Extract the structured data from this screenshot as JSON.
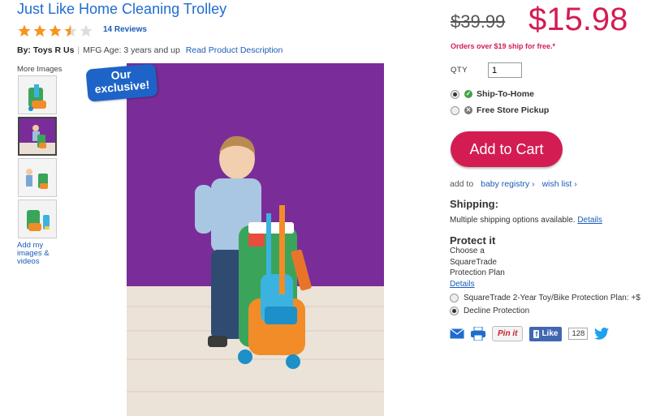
{
  "product": {
    "title": "Just Like Home Cleaning Trolley",
    "rating": 3.5,
    "rating_max": 5,
    "reviews": "14 Reviews",
    "by_label": "By: Toys R Us",
    "mfg_age": "MFG Age: 3 years and up",
    "read_description": "Read Product Description"
  },
  "gallery": {
    "more_images": "More Images",
    "add_mine": "Add my images & videos",
    "badge_line1": "Our",
    "badge_line2": "exclusive!",
    "selected_index": 1
  },
  "pricing": {
    "old_price": "$39.99",
    "new_price": "$15.98",
    "ship_note": "Orders over $19 ship for free.*"
  },
  "purchase": {
    "qty_label": "QTY",
    "qty_value": "1",
    "ship_to_home": "Ship-To-Home",
    "store_pickup": "Free Store Pickup",
    "add_to_cart": "Add to Cart",
    "add_to_prefix": "add to",
    "baby_registry": "baby registry",
    "wish_list": "wish list"
  },
  "shipping": {
    "heading": "Shipping:",
    "text": "Multiple shipping options available.",
    "details": "Details"
  },
  "protect": {
    "heading": "Protect it",
    "line1": "Choose a",
    "line2": "SquareTrade",
    "line3": "Protection Plan",
    "details": "Details",
    "option1": "SquareTrade 2-Year Toy/Bike Protection Plan:  +$",
    "option2": "Decline Protection"
  },
  "social": {
    "pinit": "Pin it",
    "like": "Like",
    "like_count": "128"
  },
  "colors": {
    "brand_blue": "#1f6cd0",
    "price_red": "#d31d52",
    "star_orange": "#f7931e",
    "backdrop_purple": "#7a2d99"
  }
}
